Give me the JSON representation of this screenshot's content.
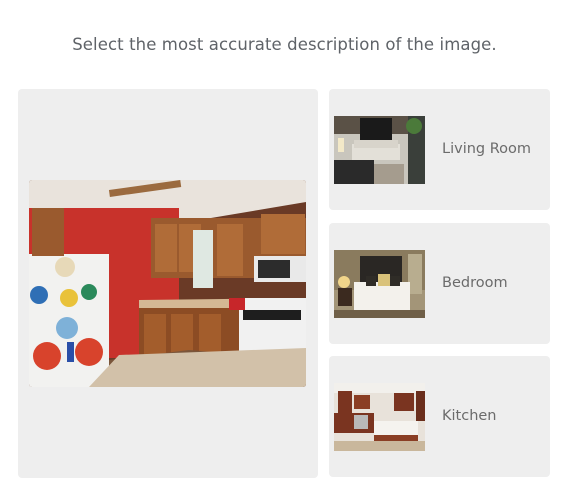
{
  "prompt": "Select the most accurate description of the image.",
  "main_image": {
    "depicts": "kitchen-photo"
  },
  "options": [
    {
      "label": "Living Room",
      "thumbnail": "living-room-photo"
    },
    {
      "label": "Bedroom",
      "thumbnail": "bedroom-photo"
    },
    {
      "label": "Kitchen",
      "thumbnail": "kitchen-photo"
    }
  ]
}
